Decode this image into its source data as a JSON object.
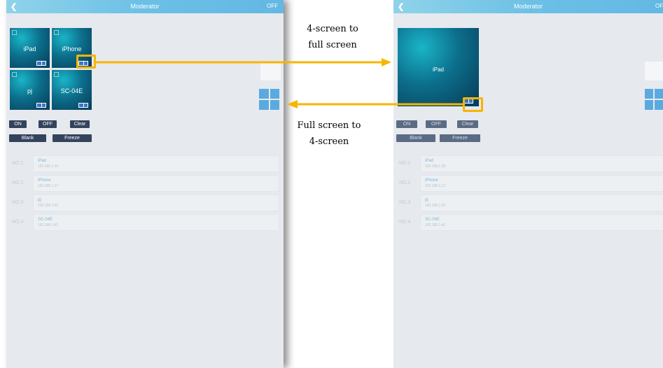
{
  "left": {
    "titlebar": {
      "back": "❮",
      "title": "Moderator",
      "off": "OFF"
    },
    "tiles": [
      {
        "name": "iPad"
      },
      {
        "name": "iPhone"
      },
      {
        "name": "pj"
      },
      {
        "name": "SC-04E"
      }
    ],
    "buttons": {
      "on": "ON",
      "off": "OFF",
      "clear": "Clear",
      "blank": "Blank",
      "freeze": "Freeze"
    },
    "list": [
      {
        "num": "NO.1",
        "name": "iPad",
        "ip": "192.168.1.39"
      },
      {
        "num": "NO.2",
        "name": "iPhone",
        "ip": "192.168.1.17"
      },
      {
        "num": "NO.3",
        "name": "pj",
        "ip": "192.168.1.62"
      },
      {
        "num": "NO.4",
        "name": "SC-04E",
        "ip": "192.168.1.41"
      }
    ]
  },
  "right": {
    "titlebar": {
      "back": "❮",
      "title": "Moderator",
      "off": "OF"
    },
    "big_tile": {
      "name": "iPad"
    },
    "buttons": {
      "on": "ON",
      "off": "OFF",
      "clear": "Clear",
      "blank": "Blank",
      "freeze": "Freeze"
    },
    "list": [
      {
        "num": "NO.1",
        "name": "iPad",
        "ip": "192.168.1.39"
      },
      {
        "num": "NO.2",
        "name": "iPhone",
        "ip": "192.168.1.17"
      },
      {
        "num": "NO.3",
        "name": "pj",
        "ip": "192.168.1.62"
      },
      {
        "num": "NO.4",
        "name": "SC-04E",
        "ip": "192.168.1.41"
      }
    ]
  },
  "annotations": {
    "to_full": [
      "4-screen to",
      "full screen"
    ],
    "to_four": [
      "Full screen to",
      "4-screen"
    ]
  },
  "colors": {
    "arrow": "#f7b500",
    "titlebar": "#6cc0e6",
    "button": "#33435c"
  }
}
